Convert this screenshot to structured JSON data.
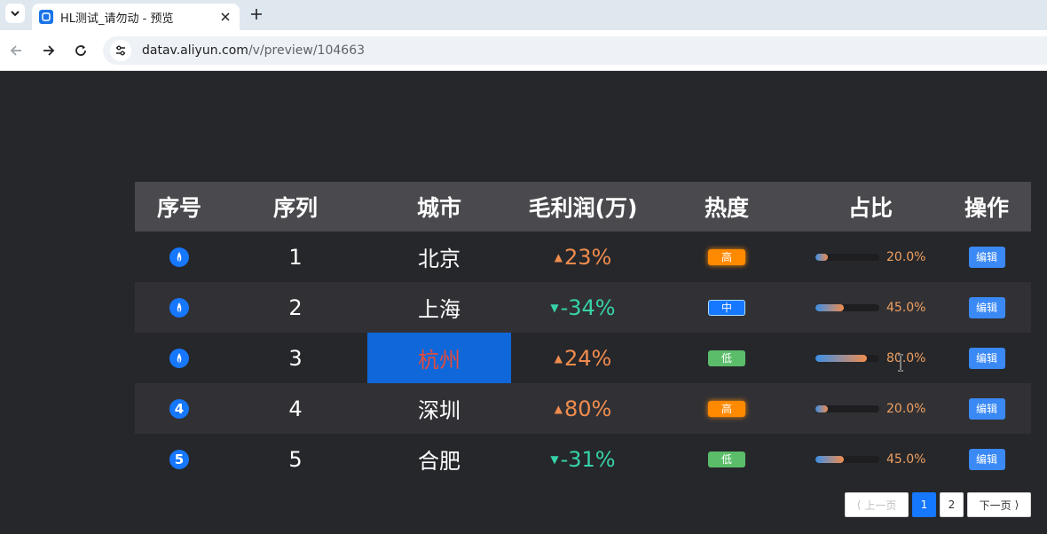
{
  "browser": {
    "tab_title": "HL测试_请勿动 - 预览",
    "url_host": "datav.aliyun.com",
    "url_path": "/v/preview/104663"
  },
  "table": {
    "headers": [
      "序号",
      "序列",
      "城市",
      "毛利润(万)",
      "热度",
      "占比",
      "操作"
    ],
    "rows": [
      {
        "rank": "",
        "seq": "1",
        "city": "北京",
        "profit": "23%",
        "trend": "up",
        "heat": "高",
        "heat_level": "high",
        "ratio": 0.2,
        "ratio_label": "20.0%",
        "action": "编辑"
      },
      {
        "rank": "",
        "seq": "2",
        "city": "上海",
        "profit": "-34%",
        "trend": "down",
        "heat": "中",
        "heat_level": "mid",
        "ratio": 0.45,
        "ratio_label": "45.0%",
        "action": "编辑"
      },
      {
        "rank": "",
        "seq": "3",
        "city": "杭州",
        "profit": "24%",
        "trend": "up",
        "heat": "低",
        "heat_level": "low",
        "ratio": 0.8,
        "ratio_label": "80.0%",
        "action": "编辑",
        "highlight": true
      },
      {
        "rank": "4",
        "seq": "4",
        "city": "深圳",
        "profit": "80%",
        "trend": "up",
        "heat": "高",
        "heat_level": "high",
        "ratio": 0.2,
        "ratio_label": "20.0%",
        "action": "编辑"
      },
      {
        "rank": "5",
        "seq": "5",
        "city": "合肥",
        "profit": "-31%",
        "trend": "down",
        "heat": "低",
        "heat_level": "low",
        "ratio": 0.45,
        "ratio_label": "45.0%",
        "action": "编辑"
      }
    ]
  },
  "pagination": {
    "prev": "上一页",
    "pages": [
      "1",
      "2"
    ],
    "current": "1",
    "next": "下一页"
  },
  "colors": {
    "background": "#26272b",
    "header": "#4a4a4e",
    "accent": "#1677ff",
    "up": "#f08c4e",
    "down": "#36d3a9"
  }
}
